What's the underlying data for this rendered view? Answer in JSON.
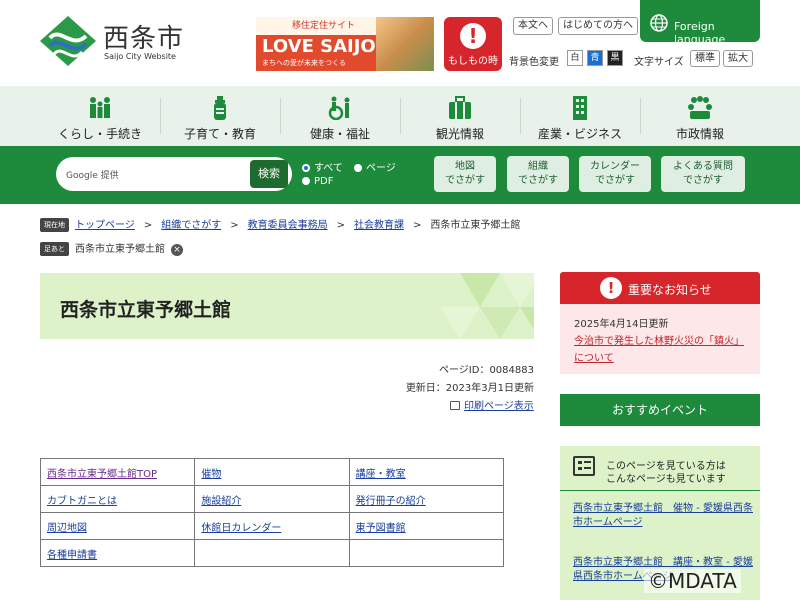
{
  "header": {
    "logo_title": "西条市",
    "logo_subtitle": "Saijo City Website",
    "banner": {
      "top_text": "移住定住サイト",
      "main_text": "LOVE SAIJO",
      "sub_text": "まちへの愛が未来をつくる"
    },
    "emergency_label": "もしもの時",
    "honbun_label": "本文へ",
    "first_time_label": "はじめての方へ",
    "foreign_language_label": "Foreign language",
    "bg_color_label": "背景色変更",
    "bg_colors": [
      {
        "label": "白",
        "color": "#ffffff",
        "text_color": "#333333"
      },
      {
        "label": "青",
        "color": "#1a6fcf",
        "text_color": "#ffffff"
      },
      {
        "label": "黒",
        "color": "#222222",
        "text_color": "#ffffff"
      }
    ],
    "font_size_label": "文字サイズ",
    "font_standard_label": "標準",
    "font_large_label": "拡大"
  },
  "nav": [
    {
      "label": "くらし・手続き",
      "icon": "people-icon"
    },
    {
      "label": "子育て・教育",
      "icon": "baby-bottle-icon"
    },
    {
      "label": "健康・福祉",
      "icon": "wheelchair-icon"
    },
    {
      "label": "観光情報",
      "icon": "suitcase-icon"
    },
    {
      "label": "産業・ビジネス",
      "icon": "building-icon"
    },
    {
      "label": "市政情報",
      "icon": "meeting-icon"
    }
  ],
  "search": {
    "google_label": "Google 提供",
    "button_label": "検索",
    "radio_all": "すべて",
    "radio_page": "ページ",
    "radio_pdf": "PDF",
    "map_line1": "地図",
    "map_line2": "でさがす",
    "org_line1": "組織",
    "org_line2": "でさがす",
    "cal_line1": "カレンダー",
    "cal_line2": "でさがす",
    "faq_line1": "よくある質問",
    "faq_line2": "でさがす"
  },
  "breadcrumb": {
    "current_tag": "現在地",
    "items": [
      "トップページ",
      "組織でさがす",
      "教育委員会事務局",
      "社会教育課",
      "西条市立東予郷土館"
    ],
    "history_tag": "足あと",
    "history_item": "西条市立東予郷土館"
  },
  "page": {
    "title": "西条市立東予郷土館",
    "page_id": "ページID：0084883",
    "updated": "更新日：2023年3月1日更新",
    "print_label": "印刷ページ表示"
  },
  "links_table": [
    [
      "西条市立東予郷土館TOP",
      "催物",
      "講座・教室"
    ],
    [
      "カブトガニとは",
      "施設紹介",
      "発行冊子の紹介"
    ],
    [
      "周辺地図",
      "休館日カレンダー",
      "東予図書館"
    ],
    [
      "各種申請書",
      "",
      ""
    ]
  ],
  "sidebar": {
    "notice_title": "重要なお知らせ",
    "notice_date": "2025年4月14日更新",
    "notice_link": "今治市で発生した林野火災の「鎮火」について",
    "events_title": "おすすめイベント",
    "viewed_line1": "このページを見ている方は",
    "viewed_line2": "こんなページも見ています",
    "viewed_item1": "西条市立東予郷土館　催物 - 愛媛県西条市ホームページ",
    "viewed_item2": "西条市立東予郷土館　講座・教室 - 愛媛県西条市ホームページ"
  },
  "watermark": "©MDATA",
  "colors": {
    "brand_green": "#1e8a3c",
    "nav_bg": "#e9f2ea",
    "title_bg": "#ddf2c8",
    "alert_red": "#d7262b",
    "link_blue": "#1a3f9c"
  }
}
